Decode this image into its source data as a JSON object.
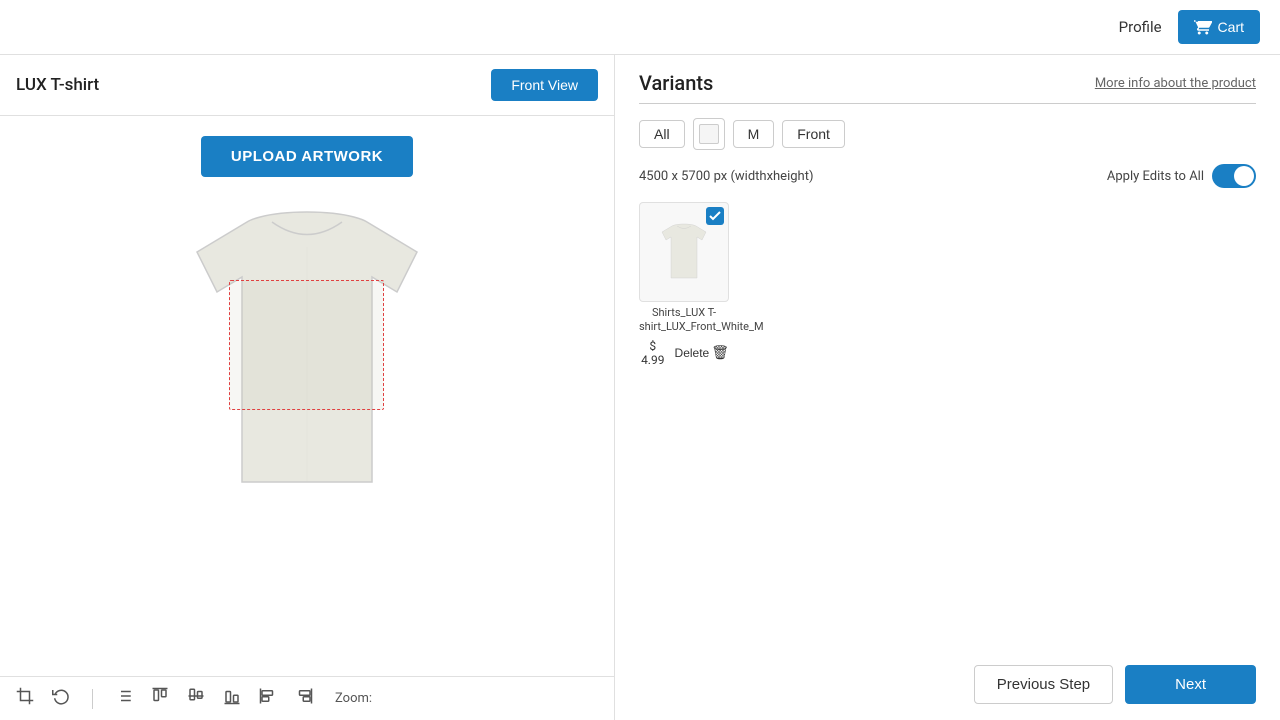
{
  "header": {
    "profile_label": "Profile",
    "cart_label": "Cart"
  },
  "left_panel": {
    "product_title": "LUX T-shirt",
    "front_view_label": "Front View",
    "upload_artwork_label": "UPLOAD ARTWORK",
    "zoom_label": "Zoom:"
  },
  "right_panel": {
    "variants_title": "Variants",
    "more_info_label": "More info about the product",
    "dimensions_text": "4500 x 5700 px (widthxheight)",
    "apply_edits_label": "Apply Edits to All",
    "filter_pills": [
      {
        "label": "All"
      },
      {
        "label": "white_swatch"
      },
      {
        "label": "M"
      },
      {
        "label": "Front"
      }
    ],
    "product_card": {
      "name": "Shirts_LUX T-shirt_LUX_Front_White_M",
      "price": "$ 4.99",
      "delete_label": "Delete"
    }
  },
  "footer": {
    "previous_step_label": "Previous Step",
    "next_label": "Next"
  }
}
